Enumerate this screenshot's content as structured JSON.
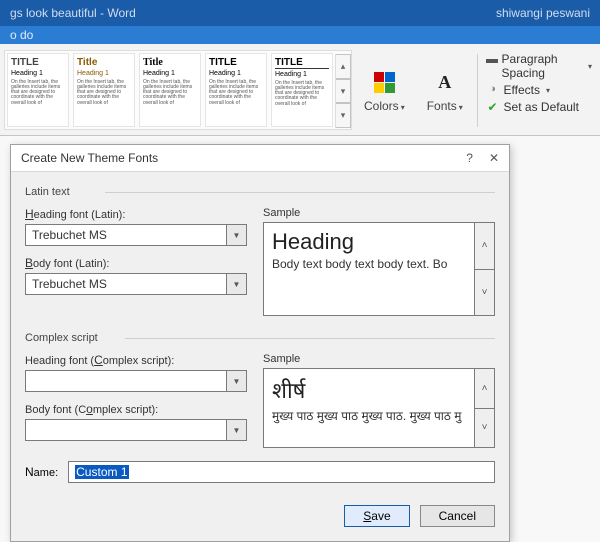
{
  "titlebar": {
    "left": "gs look beautiful  -  Word",
    "right": "shiwangi peswani"
  },
  "subbar": {
    "text": "o do"
  },
  "ribbon": {
    "gallery": [
      {
        "title": "TITLE",
        "heading": "Heading 1",
        "titleColor": "#444"
      },
      {
        "title": "Title",
        "heading": "Heading 1",
        "titleColor": "#8a5a00"
      },
      {
        "title": "Title",
        "heading": "Heading 1",
        "titleColor": "#333"
      },
      {
        "title": "TITLE",
        "heading": "Heading 1",
        "titleColor": "#222"
      },
      {
        "title": "TITLE",
        "heading": "Heading 1",
        "titleColor": "#333"
      }
    ],
    "colors_label": "Colors",
    "fonts_label": "Fonts",
    "para_spacing": "Paragraph Spacing",
    "effects": "Effects",
    "set_default": "Set as Default"
  },
  "dialog": {
    "title": "Create New Theme Fonts",
    "latin_section": "Latin text",
    "heading_font_latin_label": "Heading font (Latin):",
    "heading_font_latin_value": "Trebuchet MS",
    "body_font_latin_label": "Body font (Latin):",
    "body_font_latin_value": "Trebuchet MS",
    "sample_label": "Sample",
    "sample_heading": "Heading",
    "sample_body": "Body text body text body text. Bo",
    "complex_section": "Complex script",
    "heading_font_complex_label": "Heading font (Complex script):",
    "heading_font_complex_value": "",
    "body_font_complex_label": "Body font (Complex script):",
    "body_font_complex_value": "",
    "sample2_heading": "शीर्ष",
    "sample2_body": "मुख्य पाठ मुख्य पाठ मुख्य पाठ. मुख्य पाठ मु",
    "name_label": "Name:",
    "name_value": "Custom 1",
    "save": "Save",
    "cancel": "Cancel"
  }
}
